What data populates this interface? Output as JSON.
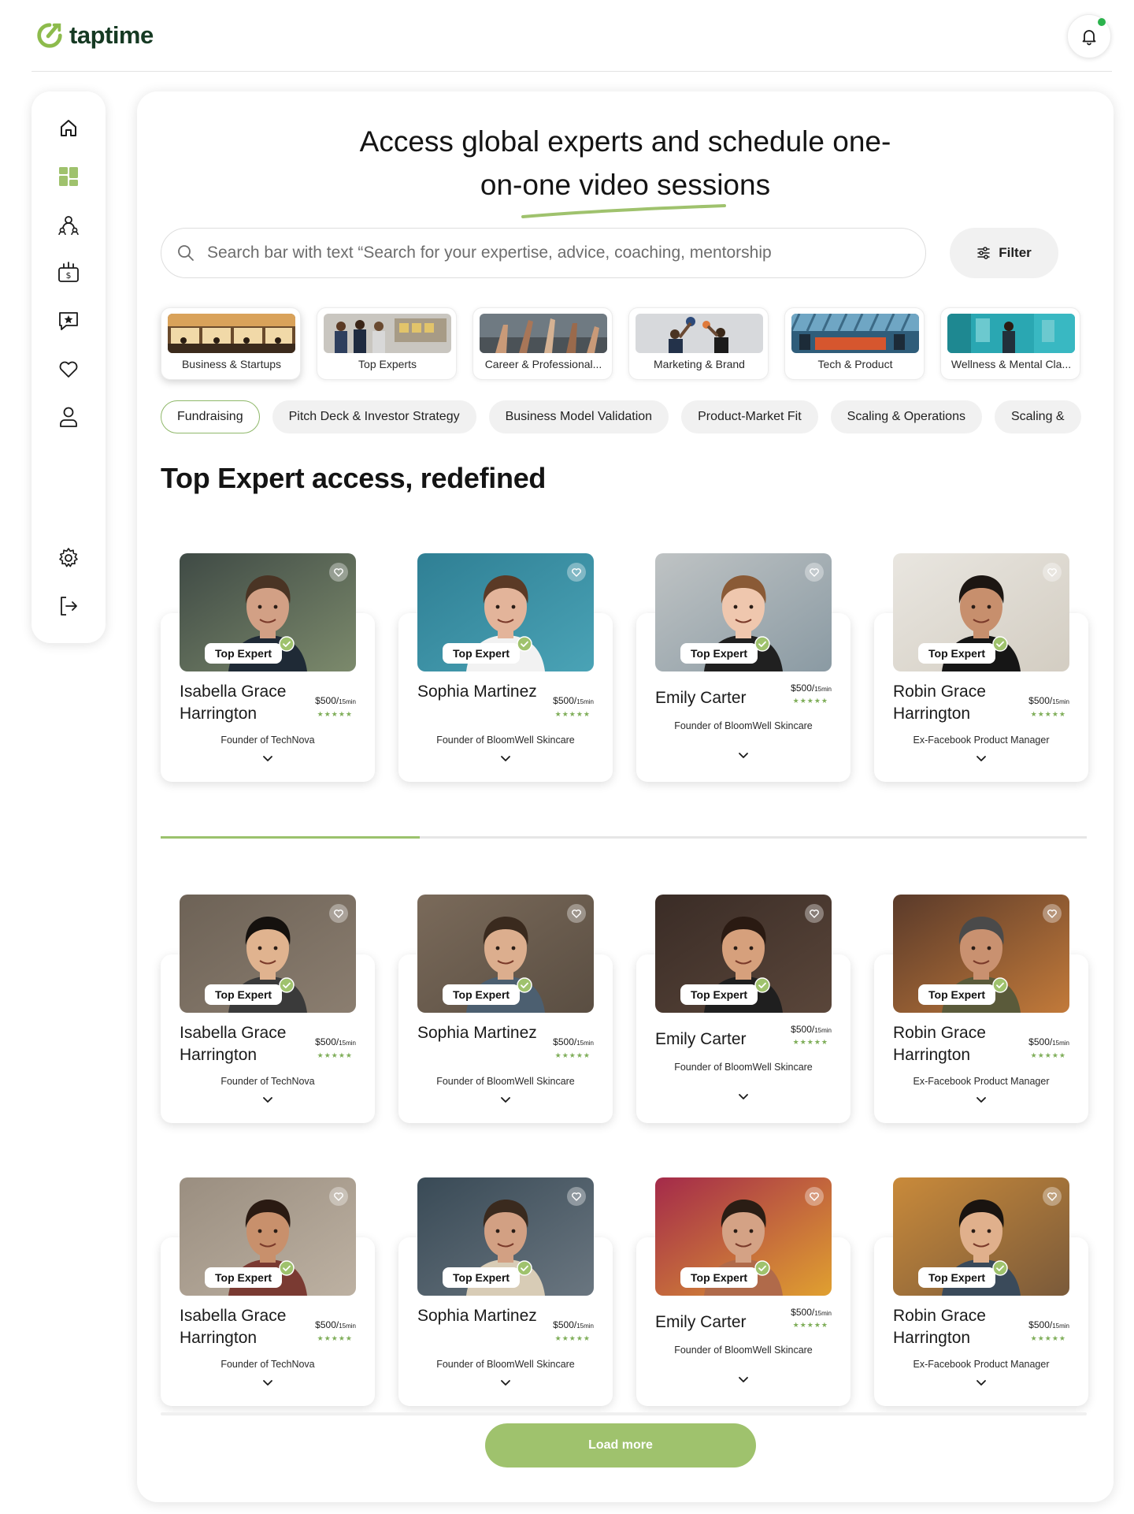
{
  "app": {
    "name": "taptime"
  },
  "header": {
    "notification_dot": true
  },
  "colors": {
    "accent": "#9fc26d",
    "brand": "#163a23",
    "star": "#7fae59"
  },
  "sidebar": {
    "items": [
      {
        "icon": "home-icon",
        "active": false
      },
      {
        "icon": "dashboard-icon",
        "active": true
      },
      {
        "icon": "community-icon",
        "active": false
      },
      {
        "icon": "payments-icon",
        "active": false
      },
      {
        "icon": "reviews-icon",
        "active": false
      },
      {
        "icon": "heart-icon",
        "active": false
      },
      {
        "icon": "profile-icon",
        "active": false
      }
    ],
    "bottom_items": [
      {
        "icon": "gear-icon"
      },
      {
        "icon": "logout-icon"
      }
    ]
  },
  "hero": {
    "line1": "Access global experts and schedule one-",
    "line2": "on-one video sessions"
  },
  "search": {
    "placeholder": "Search bar with text “Search for your expertise, advice, coaching, mentorship"
  },
  "filter": {
    "label": "Filter"
  },
  "categories": [
    {
      "label": "Business & Startups",
      "active": true
    },
    {
      "label": "Top Experts",
      "active": false
    },
    {
      "label": "Career & Professional...",
      "active": false
    },
    {
      "label": "Marketing & Brand",
      "active": false
    },
    {
      "label": "Tech & Product",
      "active": false
    },
    {
      "label": "Wellness & Mental Cla...",
      "active": false
    }
  ],
  "chips": [
    {
      "label": "Fundraising",
      "active": true
    },
    {
      "label": "Pitch Deck & Investor Strategy",
      "active": false
    },
    {
      "label": "Business Model Validation",
      "active": false
    },
    {
      "label": "Product-Market Fit",
      "active": false
    },
    {
      "label": "Scaling & Operations",
      "active": false
    },
    {
      "label": "Scaling &",
      "active": false
    }
  ],
  "section": {
    "title": "Top Expert access, redefined"
  },
  "badge_label": "Top Expert",
  "carousel_progress": 0.28,
  "experts_rows": [
    [
      {
        "name": "Isabella Grace Harrington",
        "price": "$500/",
        "unit": "15min",
        "rating_stars": "★★★★★",
        "role": "Founder of TechNova"
      },
      {
        "name": "Sophia Martinez",
        "price": "$500/",
        "unit": "15min",
        "rating_stars": "★★★★★",
        "role": "Founder of BloomWell Skincare"
      },
      {
        "name": "Emily Carter",
        "price": "$500/",
        "unit": "15min",
        "rating_stars": "★★★★★",
        "role": "Founder of BloomWell Skincare"
      },
      {
        "name": "Robin Grace Harrington",
        "price": "$500/",
        "unit": "15min",
        "rating_stars": "★★★★★",
        "role": "Ex-Facebook Product Manager"
      }
    ],
    [
      {
        "name": "Isabella Grace Harrington",
        "price": "$500/",
        "unit": "15min",
        "rating_stars": "★★★★★",
        "role": "Founder of TechNova"
      },
      {
        "name": "Sophia Martinez",
        "price": "$500/",
        "unit": "15min",
        "rating_stars": "★★★★★",
        "role": "Founder of BloomWell Skincare"
      },
      {
        "name": "Emily Carter",
        "price": "$500/",
        "unit": "15min",
        "rating_stars": "★★★★★",
        "role": "Founder of BloomWell Skincare"
      },
      {
        "name": "Robin Grace Harrington",
        "price": "$500/",
        "unit": "15min",
        "rating_stars": "★★★★★",
        "role": "Ex-Facebook Product Manager"
      }
    ],
    [
      {
        "name": "Isabella Grace Harrington",
        "price": "$500/",
        "unit": "15min",
        "rating_stars": "★★★★★",
        "role": "Founder of TechNova"
      },
      {
        "name": "Sophia Martinez",
        "price": "$500/",
        "unit": "15min",
        "rating_stars": "★★★★★",
        "role": "Founder of BloomWell Skincare"
      },
      {
        "name": "Emily Carter",
        "price": "$500/",
        "unit": "15min",
        "rating_stars": "★★★★★",
        "role": "Founder of BloomWell Skincare"
      },
      {
        "name": "Robin Grace Harrington",
        "price": "$500/",
        "unit": "15min",
        "rating_stars": "★★★★★",
        "role": "Ex-Facebook Product Manager"
      }
    ]
  ],
  "load_more": {
    "label": "Load more"
  }
}
